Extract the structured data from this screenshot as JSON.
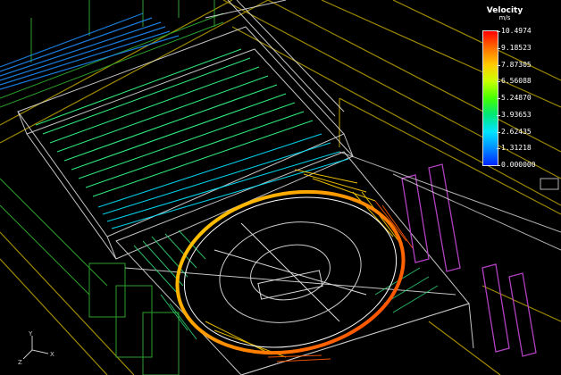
{
  "legend": {
    "title": "Velocity",
    "unit": "m/s",
    "ticks": [
      "10.4974",
      "9.18523",
      "7.87305",
      "6.56088",
      "5.24870",
      "3.93653",
      "2.62435",
      "1.31218",
      "0.000000"
    ]
  },
  "axes": {
    "x_label": "X",
    "y_label": "Y",
    "z_label": "Z"
  },
  "colors": {
    "background": "#000000",
    "wireframe": "#ffffff",
    "structure": "#c9b000",
    "green_lines": "#2ca02c",
    "magenta": "#b040c0",
    "disc": "#ff8c00"
  }
}
